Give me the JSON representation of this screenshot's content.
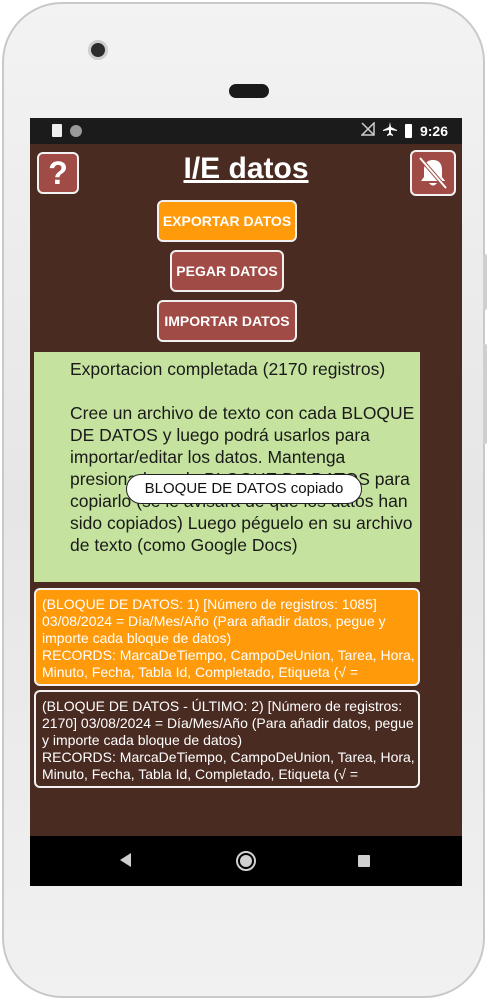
{
  "status_bar": {
    "time": "9:26",
    "left_icons": [
      "sim-card-icon",
      "circle-dot-icon"
    ],
    "right_icons": [
      "no-signal-icon",
      "airplane-icon",
      "battery-icon"
    ]
  },
  "app": {
    "title": "I/E datos",
    "help_label": "?",
    "help_icon": "question-icon",
    "mute_icon": "bell-off-icon"
  },
  "buttons": {
    "export": "EXPORTAR DATOS",
    "paste": "PEGAR DATOS",
    "import": "IMPORTAR DATOS"
  },
  "info": {
    "line1": "Exportacion completada (2170 registros)",
    "line2": "Cree un archivo de texto con cada BLOQUE DE DATOS y luego podrá usarlos para importar/editar los datos. Mantenga presionado cada BLOQUE DE DATOS para copiarlo (se le avisará de que los datos han sido copiados) Luego péguelo en su archivo de texto (como Google Docs)"
  },
  "toast": "BLOQUE DE DATOS copiado",
  "blocks": [
    {
      "line1": "(BLOQUE DE DATOS: 1) [Número de registros: 1085] 03/08/2024 = Día/Mes/Año (Para añadir datos, pegue y importe cada bloque de datos)",
      "line2": "RECORDS: MarcaDeTiempo, CampoDeUnion, Tarea, Hora, Minuto, Fecha, Tabla Id, Completado, Etiqueta (√ ="
    },
    {
      "line1": "(BLOQUE DE DATOS - ÚLTIMO: 2) [Número de registros: 2170] 03/08/2024 = Día/Mes/Año (Para añadir datos, pegue y importe cada bloque de datos)",
      "line2": "RECORDS: MarcaDeTiempo, CampoDeUnion, Tarea, Hora, Minuto, Fecha, Tabla Id, Completado, Etiqueta (√ ="
    }
  ],
  "nav_bar": {
    "icons": [
      "back-triangle-icon",
      "home-circle-icon",
      "recents-square-icon"
    ]
  },
  "colors": {
    "background": "#4a2b22",
    "accent_orange": "#ff9a0a",
    "button_red": "#a04b45",
    "info_green": "#c5e39e"
  }
}
